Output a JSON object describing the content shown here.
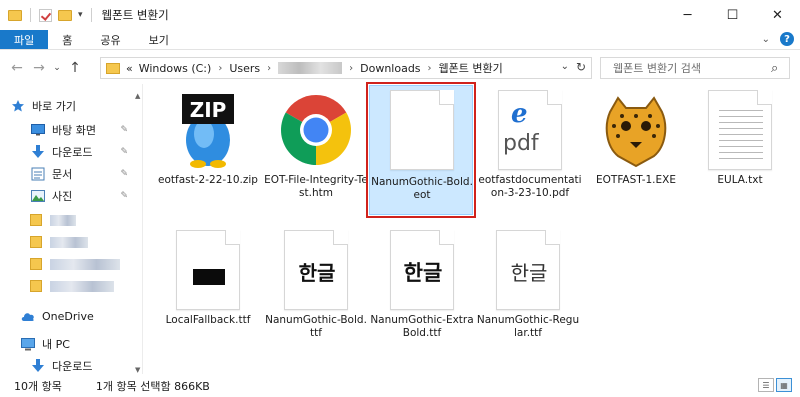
{
  "window": {
    "title": "웹폰트 변환기",
    "controls": {
      "minimize": "─",
      "maximize": "☐",
      "close": "✕"
    }
  },
  "ribbon": {
    "tabs": [
      "파일",
      "홈",
      "공유",
      "보기"
    ],
    "expand_glyph": "⌄",
    "help_glyph": "?"
  },
  "navigation": {
    "back": "←",
    "forward": "→",
    "recent": "⌄",
    "up": "↑",
    "address": {
      "prefix": "«",
      "crumbs": [
        "Windows (C:)",
        "Users",
        "Downloads",
        "웹폰트 변환기"
      ],
      "separator": "›",
      "dropdown": "⌄",
      "refresh": "↻"
    },
    "search": {
      "placeholder": "웹폰트 변환기 검색",
      "icon": "⌕"
    }
  },
  "sidebar": {
    "quick_access": "바로 가기",
    "items": [
      {
        "label": "바탕 화면",
        "icon": "desktop-icon",
        "pinned": true
      },
      {
        "label": "다운로드",
        "icon": "download-icon",
        "pinned": true
      },
      {
        "label": "문서",
        "icon": "document-icon",
        "pinned": true
      },
      {
        "label": "사진",
        "icon": "pictures-icon",
        "pinned": true
      }
    ],
    "onedrive": "OneDrive",
    "this_pc": "내 PC",
    "pc_downloads": "다운로드",
    "pin_glyph": "📌"
  },
  "files": [
    {
      "name": "eotfast-2-22-10.zip",
      "icon": "zip-archive-icon",
      "badge": "ZIP"
    },
    {
      "name": "EOT-File-Integrity-Test.htm",
      "icon": "chrome-icon"
    },
    {
      "name": "NanumGothic-Bold.eot",
      "icon": "blank-file-icon",
      "selected": true
    },
    {
      "name": "eotfastdocumentation-3-23-10.pdf",
      "icon": "pdf-edge-icon",
      "glyph_top": "e",
      "glyph_bottom": "pdf"
    },
    {
      "name": "EOTFAST-1.EXE",
      "icon": "cheetah-icon"
    },
    {
      "name": "EULA.txt",
      "icon": "text-file-icon"
    },
    {
      "name": "LocalFallback.ttf",
      "icon": "font-file-icon"
    },
    {
      "name": "NanumGothic-Bold.ttf",
      "icon": "font-file-icon",
      "glyph": "한글"
    },
    {
      "name": "NanumGothic-ExtraBold.ttf",
      "icon": "font-file-icon",
      "glyph": "한글"
    },
    {
      "name": "NanumGothic-Regular.ttf",
      "icon": "font-file-icon",
      "glyph": "한글"
    }
  ],
  "status": {
    "count": "10개 항목",
    "selection": "1개 항목 선택함 866KB"
  },
  "colors": {
    "accent": "#1979ca",
    "selection": "#cce8ff",
    "highlight_box": "#d0221c",
    "folder": "#f5c74e"
  }
}
